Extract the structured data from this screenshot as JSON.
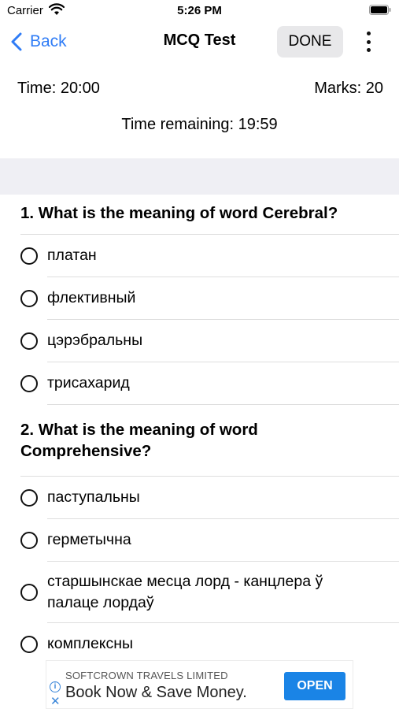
{
  "status_bar": {
    "carrier": "Carrier",
    "time": "5:26 PM"
  },
  "nav": {
    "back_label": "Back",
    "title": "MCQ Test",
    "done_label": "DONE"
  },
  "info": {
    "time": "Time: 20:00",
    "marks": "Marks: 20",
    "remaining": "Time remaining: 19:59"
  },
  "questions": [
    {
      "text": "1. What is the meaning of word Cerebral?",
      "options": [
        "платан",
        "флективный",
        "цэрэбральны",
        "трисахарид"
      ]
    },
    {
      "text": "2. What is the meaning of word Comprehensive?",
      "options": [
        "паступальны",
        "герметычна",
        "старшынскае месца лорд - канцлера ў палаце лордаў",
        "комплексны"
      ]
    }
  ],
  "ad": {
    "sponsor": "SOFTCROWN TRAVELS LIMITED",
    "headline": "Book Now & Save Money.",
    "cta": "OPEN",
    "accent_color": "#1a84e6"
  },
  "colors": {
    "link": "#2f7cf6",
    "section_band": "#efeff4"
  }
}
